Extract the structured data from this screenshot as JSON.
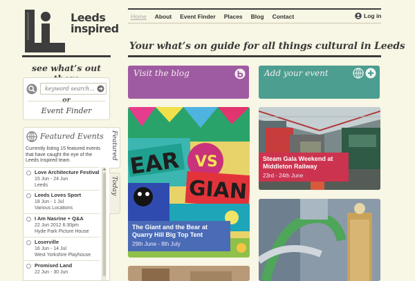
{
  "logo": {
    "word1": "Leeds",
    "word2": "inspired"
  },
  "tagline": "see what’s out there",
  "search": {
    "placeholder": "keyword search...",
    "or_label": "or",
    "event_finder_label": "Event Finder"
  },
  "featured": {
    "title": "Featured Events",
    "description": "Currently listing 15 featured events that have caught the eye of the Leeds Inspired team.",
    "items": [
      {
        "title": "Love Architecture Festival",
        "line1": "15 Jun - 24 Jun",
        "line2": "Leeds"
      },
      {
        "title": "Leeds Loves Sport",
        "line1": "18 Jun - 1 Jul",
        "line2": "Various Locations"
      },
      {
        "title": "I Am Nasrine + Q&A",
        "line1": "22 Jun 2012 6:30pm",
        "line2": "Hyde Park Picture House"
      },
      {
        "title": "Loserville",
        "line1": "16 Jun - 14 Jul",
        "line2": "West Yorkshire Playhouse"
      },
      {
        "title": "Promised Land",
        "line1": "22 Jun - 30 Jun",
        "line2": ""
      }
    ],
    "tabs": {
      "featured": "Featured",
      "today": "Today"
    }
  },
  "nav": {
    "items": [
      "Home",
      "About",
      "Event Finder",
      "Places",
      "Blog",
      "Contact"
    ],
    "active": "Home",
    "login_label": "Log in"
  },
  "headline": "Your what’s on guide for all things cultural in Leeds",
  "cta": {
    "blog_label": "Visit the blog",
    "event_label": "Add your event"
  },
  "tiles": {
    "giant": {
      "title": "The Giant and the Bear at Quarry Hill Big Top Tent",
      "date": "29th June - 8th July",
      "art_text_1": "EAR",
      "art_text_2": "VS",
      "art_text_3": "GIAN"
    },
    "steam": {
      "title": "Steam Gala Weekend at Middleton Railway",
      "date": "23rd - 24th June"
    }
  },
  "colors": {
    "background": "#f8f6e4",
    "blog": "#9f5ba1",
    "event": "#4c9e90",
    "giant_caption": "#4a6bb6",
    "steam_caption": "#cc334e"
  }
}
